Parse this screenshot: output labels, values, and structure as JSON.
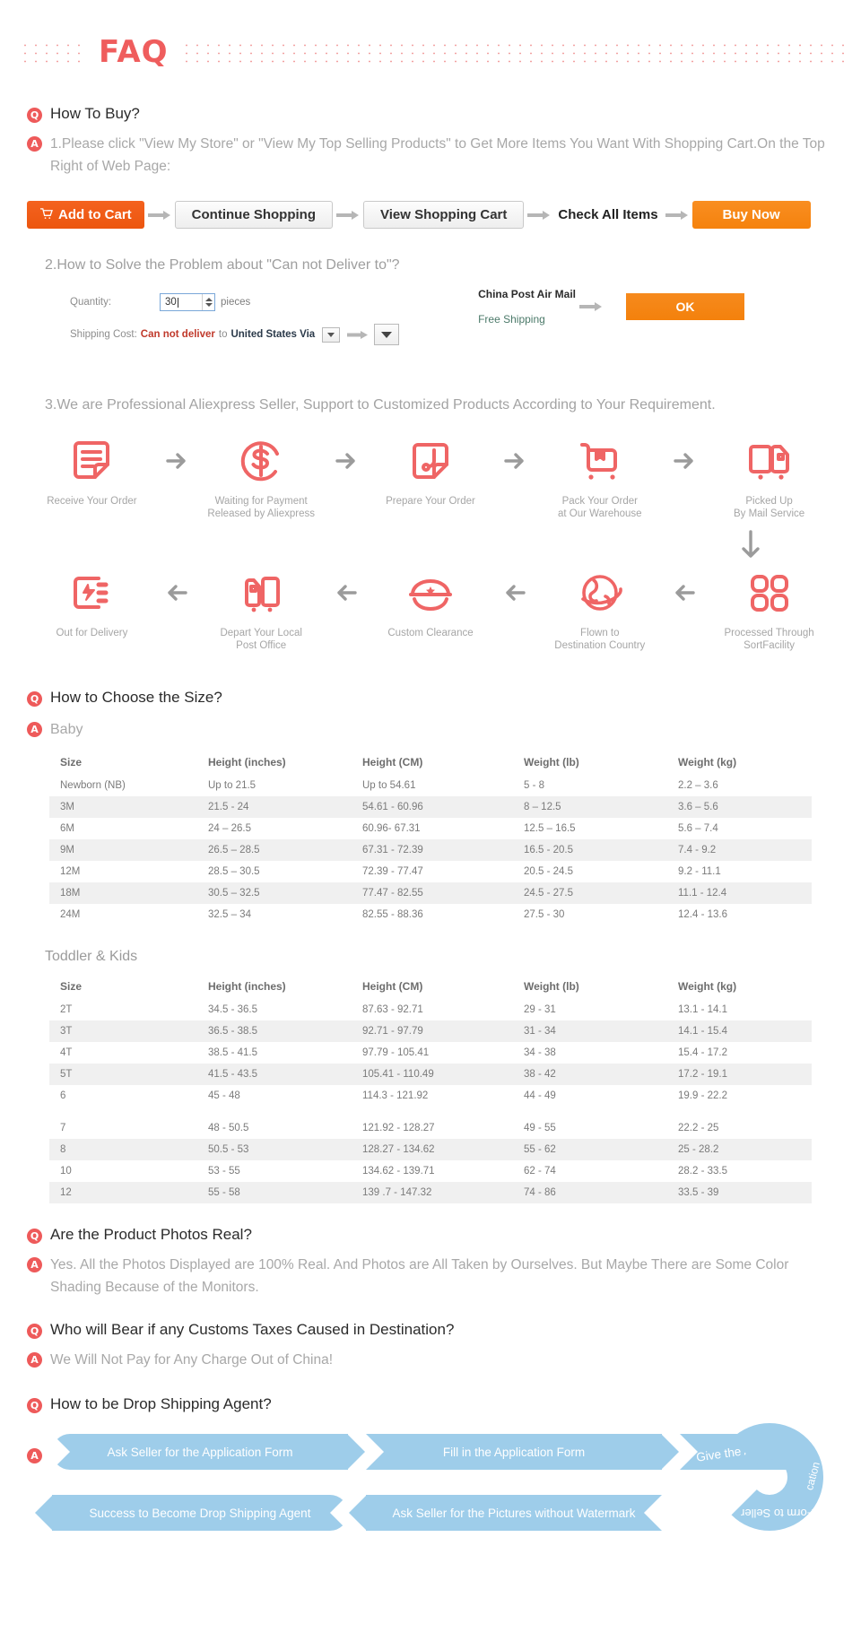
{
  "banner": {
    "title": "FAQ"
  },
  "sections": {
    "how_to_buy": {
      "q_label": "Q",
      "a_label": "A",
      "question": "How To Buy?",
      "answer": "1.Please click \"View My Store\" or \"View My Top Selling Products\" to Get More Items You Want With Shopping Cart.On the Top Right of Web Page:",
      "buttons": [
        {
          "label": "Add to Cart",
          "icon": "shopping-cart-icon",
          "style": "orange-dark"
        },
        {
          "label": "Continue Shopping",
          "style": "grey"
        },
        {
          "label": "View Shopping Cart",
          "style": "grey"
        },
        {
          "label": "Check All Items",
          "style": "plain"
        },
        {
          "label": "Buy Now",
          "style": "orange"
        }
      ],
      "step2_title": "2.How to Solve the Problem about \"Can not Deliver to\"?",
      "form": {
        "quantity_label": "Quantity:",
        "quantity_value": "30",
        "quantity_unit": "pieces",
        "shipping_label": "Shipping Cost:",
        "cannot_deliver": "Can not deliver",
        "to_word": "to",
        "country": "United States Via",
        "ship_method": "China Post Air Mail",
        "ship_price": "Free Shipping",
        "ok_label": "OK"
      },
      "step3_title": "3.We are Professional Aliexpress Seller, Support to Customized Products According to Your Requirement.",
      "process_row1": [
        {
          "icon": "document-lines-icon",
          "label": "Receive Your Order"
        },
        {
          "icon": "dollar-circle-icon",
          "label": "Waiting for Payment\nReleased by Aliexpress"
        },
        {
          "icon": "scissors-box-icon",
          "label": "Prepare Your Order"
        },
        {
          "icon": "package-cart-icon",
          "label": "Pack Your Order\nat Our Warehouse"
        },
        {
          "icon": "mail-truck-icon",
          "label": "Picked Up\nBy Mail Service"
        }
      ],
      "process_row2": [
        {
          "icon": "delivery-van-icon",
          "label": "Out for Delivery"
        },
        {
          "icon": "post-office-icon",
          "label": "Depart Your Local\nPost Office"
        },
        {
          "icon": "customs-hat-icon",
          "label": "Custom Clearance"
        },
        {
          "icon": "globe-plane-icon",
          "label": "Flown to\nDestination Country"
        },
        {
          "icon": "sort-facility-icon",
          "label": "Processed Through\nSortFacility"
        }
      ]
    },
    "size_guide": {
      "question": "How to Choose the Size?",
      "baby": {
        "title": "Baby",
        "headers": [
          "Size",
          "Height (inches)",
          "Height (CM)",
          "Weight (lb)",
          "Weight (kg)"
        ],
        "rows": [
          [
            "Newborn (NB)",
            "Up to 21.5",
            "Up to 54.61",
            "5 - 8",
            "2.2 – 3.6"
          ],
          [
            "3M",
            "21.5 - 24",
            "54.61 - 60.96",
            "8 – 12.5",
            "3.6 – 5.6"
          ],
          [
            "6M",
            "24 – 26.5",
            "60.96- 67.31",
            "12.5 – 16.5",
            "5.6 – 7.4"
          ],
          [
            "9M",
            "26.5 – 28.5",
            "67.31 - 72.39",
            "16.5 - 20.5",
            "7.4 - 9.2"
          ],
          [
            "12M",
            "28.5 – 30.5",
            "72.39 - 77.47",
            "20.5 - 24.5",
            "9.2 - 11.1"
          ],
          [
            "18M",
            "30.5 – 32.5",
            "77.47 - 82.55",
            "24.5 - 27.5",
            "11.1 - 12.4"
          ],
          [
            "24M",
            "32.5 – 34",
            "82.55 - 88.36",
            "27.5 - 30",
            "12.4 - 13.6"
          ]
        ]
      },
      "kids": {
        "title": "Toddler & Kids",
        "headers": [
          "Size",
          "Height (inches)",
          "Height (CM)",
          "Weight (lb)",
          "Weight (kg)"
        ],
        "rows": [
          [
            "2T",
            "34.5 - 36.5",
            "87.63 - 92.71",
            "29 - 31",
            "13.1 - 14.1"
          ],
          [
            "3T",
            "36.5 - 38.5",
            "92.71 - 97.79",
            "31 - 34",
            "14.1 - 15.4"
          ],
          [
            "4T",
            "38.5 - 41.5",
            "97.79 - 105.41",
            "34 - 38",
            "15.4 - 17.2"
          ],
          [
            "5T",
            "41.5 - 43.5",
            "105.41 - 110.49",
            "38 - 42",
            "17.2 - 19.1"
          ],
          [
            "6",
            "45 - 48",
            "114.3 - 121.92",
            "44 - 49",
            "19.9 - 22.2"
          ],
          [
            "",
            "",
            "",
            "",
            ""
          ],
          [
            "7",
            "48 - 50.5",
            "121.92 - 128.27",
            "49 - 55",
            "22.2 - 25"
          ],
          [
            "8",
            "50.5 - 53",
            "128.27 - 134.62",
            "55 - 62",
            "25 - 28.2"
          ],
          [
            "10",
            "53 - 55",
            "134.62 - 139.71",
            "62 - 74",
            "28.2 - 33.5"
          ],
          [
            "12",
            "55 - 58",
            "139 .7 - 147.32",
            "74 - 86",
            "33.5 - 39"
          ]
        ]
      }
    },
    "photos_real": {
      "question": "Are the Product Photos Real?",
      "answer": "Yes. All the Photos Displayed are 100% Real. And Photos are All Taken by Ourselves. But Maybe There are Some Color Shading Because of the Monitors."
    },
    "customs": {
      "question": "Who will Bear if any Customs Taxes Caused in Destination?",
      "answer": "We Will Not Pay for Any Charge Out of China!"
    },
    "drop_shipping": {
      "question": "How to be Drop Shipping Agent?",
      "steps_top": [
        "Ask Seller for the Application Form",
        "Fill in the Application Form"
      ],
      "curve_step": "Give the Application Form to Seller",
      "curve_part1": "Give the Appli",
      "curve_part2": "cation",
      "curve_part3": "Form to Seller",
      "steps_bottom": [
        "Success to Become Drop Shipping Agent",
        "Ask Seller for the Pictures without Watermark"
      ]
    }
  },
  "colors": {
    "accent_red": "#ee5a5a",
    "icon_red": "#ef6565",
    "orange_dark": "#ef5a12",
    "orange": "#f5820d",
    "blue_chevron": "#9ecdea",
    "grey_text": "#a8a8a8"
  }
}
